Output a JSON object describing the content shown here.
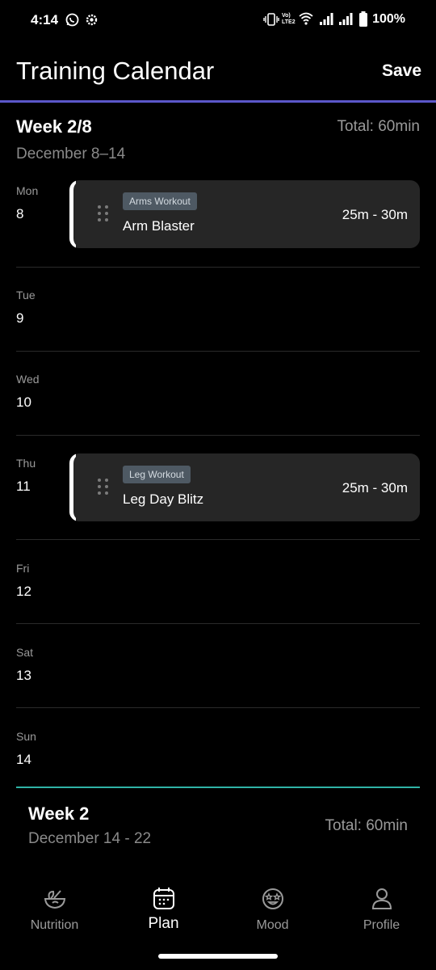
{
  "status": {
    "time": "4:14",
    "battery": "100%",
    "network_text": "Vo) LTE2"
  },
  "header": {
    "title": "Training Calendar",
    "save_label": "Save"
  },
  "week": {
    "title": "Week 2/8",
    "total": "Total: 60min",
    "dates": "December 8–14"
  },
  "days": [
    {
      "name": "Mon",
      "num": "8"
    },
    {
      "name": "Tue",
      "num": "9"
    },
    {
      "name": "Wed",
      "num": "10"
    },
    {
      "name": "Thu",
      "num": "11"
    },
    {
      "name": "Fri",
      "num": "12"
    },
    {
      "name": "Sat",
      "num": "13"
    },
    {
      "name": "Sun",
      "num": "14"
    }
  ],
  "workouts": [
    {
      "tag": "Arms Workout",
      "name": "Arm Blaster",
      "range": "25m - 30m"
    },
    {
      "tag": "Leg Workout",
      "name": "Leg Day Blitz",
      "range": "25m - 30m"
    }
  ],
  "next_week": {
    "title": "Week 2",
    "dates": "December 14 - 22",
    "total": "Total: 60min"
  },
  "nav": [
    {
      "label": "Nutrition",
      "icon": "nutrition-bowl-icon"
    },
    {
      "label": "Plan",
      "icon": "calendar-icon"
    },
    {
      "label": "Mood",
      "icon": "mood-face-icon"
    },
    {
      "label": "Profile",
      "icon": "person-icon"
    }
  ],
  "colors": {
    "accent_line": "#5b57c9",
    "week_divider": "#2fb3a6",
    "card_bg": "#262626",
    "tag_bg": "#4e5963"
  }
}
